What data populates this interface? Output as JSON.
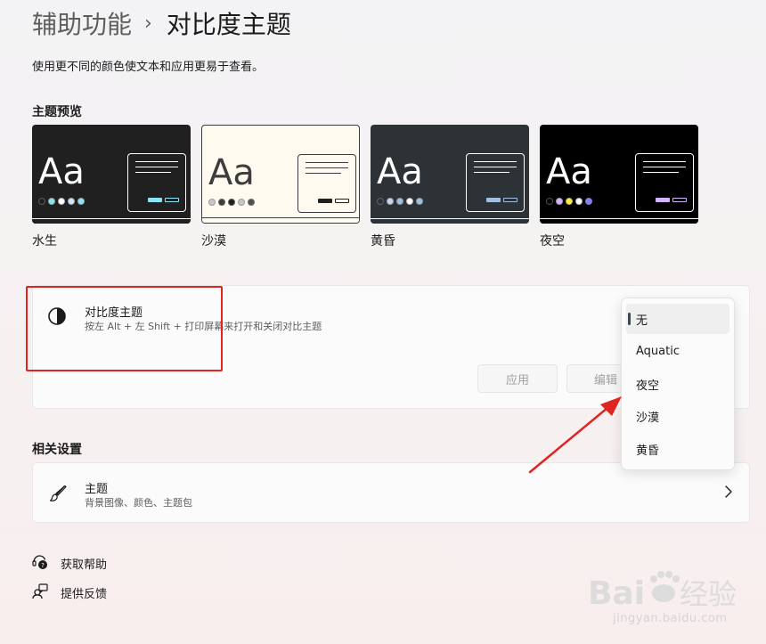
{
  "header": {
    "parent": "辅助功能",
    "separator": "›",
    "current": "对比度主题"
  },
  "description": "使用更不同的颜色使文本和应用更易于查看。",
  "preview": {
    "title": "主题预览",
    "themes": [
      {
        "label": "水生",
        "aa": "Aa",
        "bg": "#202020",
        "fg": "#ffffff",
        "accent": "#8ee3f0",
        "dots": [
          "#202020",
          "#8ee3f0",
          "#ffffff",
          "#d4e4f7",
          "#8ee3f0"
        ]
      },
      {
        "label": "沙漠",
        "aa": "Aa",
        "bg": "#fffaef",
        "fg": "#3d3d3d",
        "accent": "#202020",
        "dots": [
          "#c7c7c7",
          "#3d3d3d",
          "#202020",
          "#c7c7c7",
          "#505050"
        ]
      },
      {
        "label": "黄昏",
        "aa": "Aa",
        "bg": "#2d3236",
        "fg": "#ffffff",
        "accent": "#a1bfde",
        "dots": [
          "#2d3236",
          "#c5d5ec",
          "#a1bfde",
          "#ffffff",
          "#a1bfde"
        ]
      },
      {
        "label": "夜空",
        "aa": "Aa",
        "bg": "#000000",
        "fg": "#ffffff",
        "accent": "#d6b4fd",
        "dots": [
          "#000000",
          "#d6b4fd",
          "#ffee32",
          "#ffffff",
          "#8080ff"
        ]
      }
    ]
  },
  "contrast": {
    "title": "对比度主题",
    "subtitle": "按左 Alt + 左 Shift + 打印屏幕来打开和关闭对比主题",
    "apply_label": "应用",
    "edit_label": "编辑"
  },
  "dropdown": {
    "options": [
      "无",
      "Aquatic",
      "夜空",
      "沙漠",
      "黄昏"
    ],
    "selected": "无"
  },
  "related": {
    "title": "相关设置",
    "themes_title": "主题",
    "themes_sub": "背景图像、颜色、主题包"
  },
  "footer": {
    "help": "获取帮助",
    "feedback": "提供反馈"
  },
  "watermark": {
    "brand": "Baidu经验",
    "url": "jingyan.baidu.com"
  },
  "colors": {
    "highlight_red": "#e0241f",
    "selection_indicator": "#3a4660"
  }
}
